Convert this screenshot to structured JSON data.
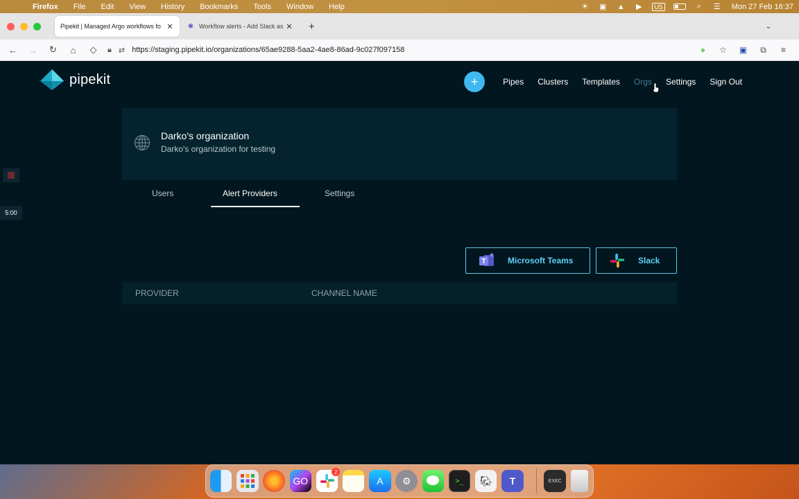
{
  "menubar": {
    "app": "Firefox",
    "items": [
      "File",
      "Edit",
      "View",
      "History",
      "Bookmarks",
      "Tools",
      "Window",
      "Help"
    ],
    "input_source": "US",
    "clock": "Mon 27 Feb 16:37"
  },
  "browser": {
    "tabs": [
      {
        "title": "Pipekit | Managed Argo workflows fo",
        "active": true
      },
      {
        "title": "Workflow alerts - Add Slack as a",
        "active": false
      }
    ],
    "url": "https://staging.pipekit.io/organizations/65ae9288-5aa2-4ae8-86ad-9c027f097158"
  },
  "app": {
    "logo_text": "pipekit",
    "nav": {
      "add_label": "+",
      "links": [
        "Pipes",
        "Clusters",
        "Templates",
        "Orgs",
        "Settings",
        "Sign Out"
      ],
      "current": "Orgs"
    },
    "org": {
      "name": "Darko's organization",
      "description": "Darko's organization for testing"
    },
    "subtabs": [
      "Users",
      "Alert Providers",
      "Settings"
    ],
    "active_subtab": "Alert Providers",
    "providers": {
      "teams_label": "Microsoft Teams",
      "slack_label": "Slack"
    },
    "table": {
      "columns": [
        "PROVIDER",
        "CHANNEL NAME"
      ]
    },
    "recorder": {
      "timer": "5:00"
    }
  },
  "dock": {
    "apps": [
      "finder",
      "launchpad",
      "firefox",
      "goland",
      "slack",
      "notes",
      "app-store",
      "system-settings",
      "messages",
      "terminal",
      "pgadmin",
      "teams",
      "console",
      "trash"
    ],
    "slack_badge": "2"
  },
  "colors": {
    "app_bg": "#02161f",
    "card_bg": "#04232f",
    "accent": "#41b8f0",
    "provider_border": "#5fc7ee"
  }
}
